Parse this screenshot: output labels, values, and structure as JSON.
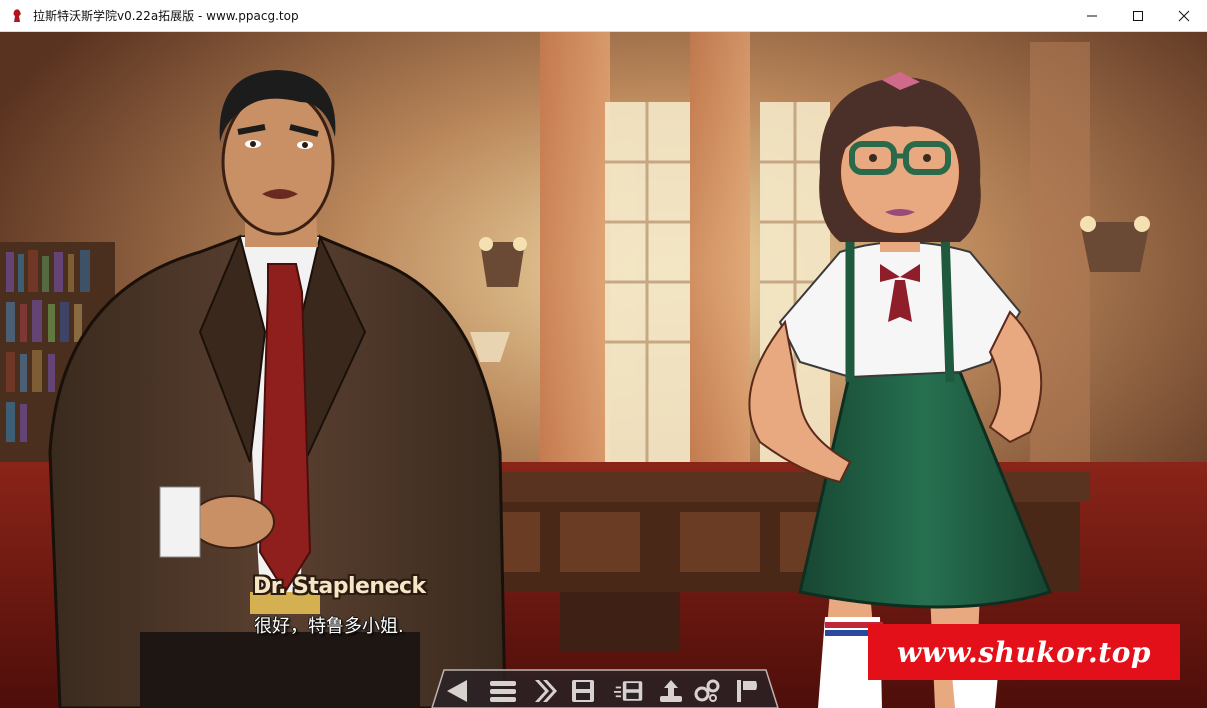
{
  "window": {
    "title": "拉斯特沃斯学院v0.22a拓展版 - www.ppacg.top",
    "controls": [
      "minimize",
      "maximize",
      "close"
    ]
  },
  "dialogue": {
    "speaker": "Dr. Stapleneck",
    "text": "很好，特鲁多小姐."
  },
  "watermark": {
    "text": "www.shukor.top",
    "color": "#e3101a"
  },
  "quick_menu": {
    "buttons": [
      {
        "name": "back",
        "icon": "back-arrow-icon"
      },
      {
        "name": "history",
        "icon": "history-icon"
      },
      {
        "name": "skip",
        "icon": "skip-icon"
      },
      {
        "name": "save",
        "icon": "save-icon"
      },
      {
        "name": "quick-save",
        "icon": "quick-save-icon"
      },
      {
        "name": "quick-load",
        "icon": "load-icon"
      },
      {
        "name": "preferences",
        "icon": "gears-icon"
      },
      {
        "name": "auto",
        "icon": "flag-icon"
      }
    ]
  },
  "colors": {
    "room_wall": "#8a5a3a",
    "carpet": "#7a1a14",
    "skirt_green": "#1f5a3e",
    "suit_brown": "#4a3426",
    "tie_red": "#8e1f1c"
  }
}
